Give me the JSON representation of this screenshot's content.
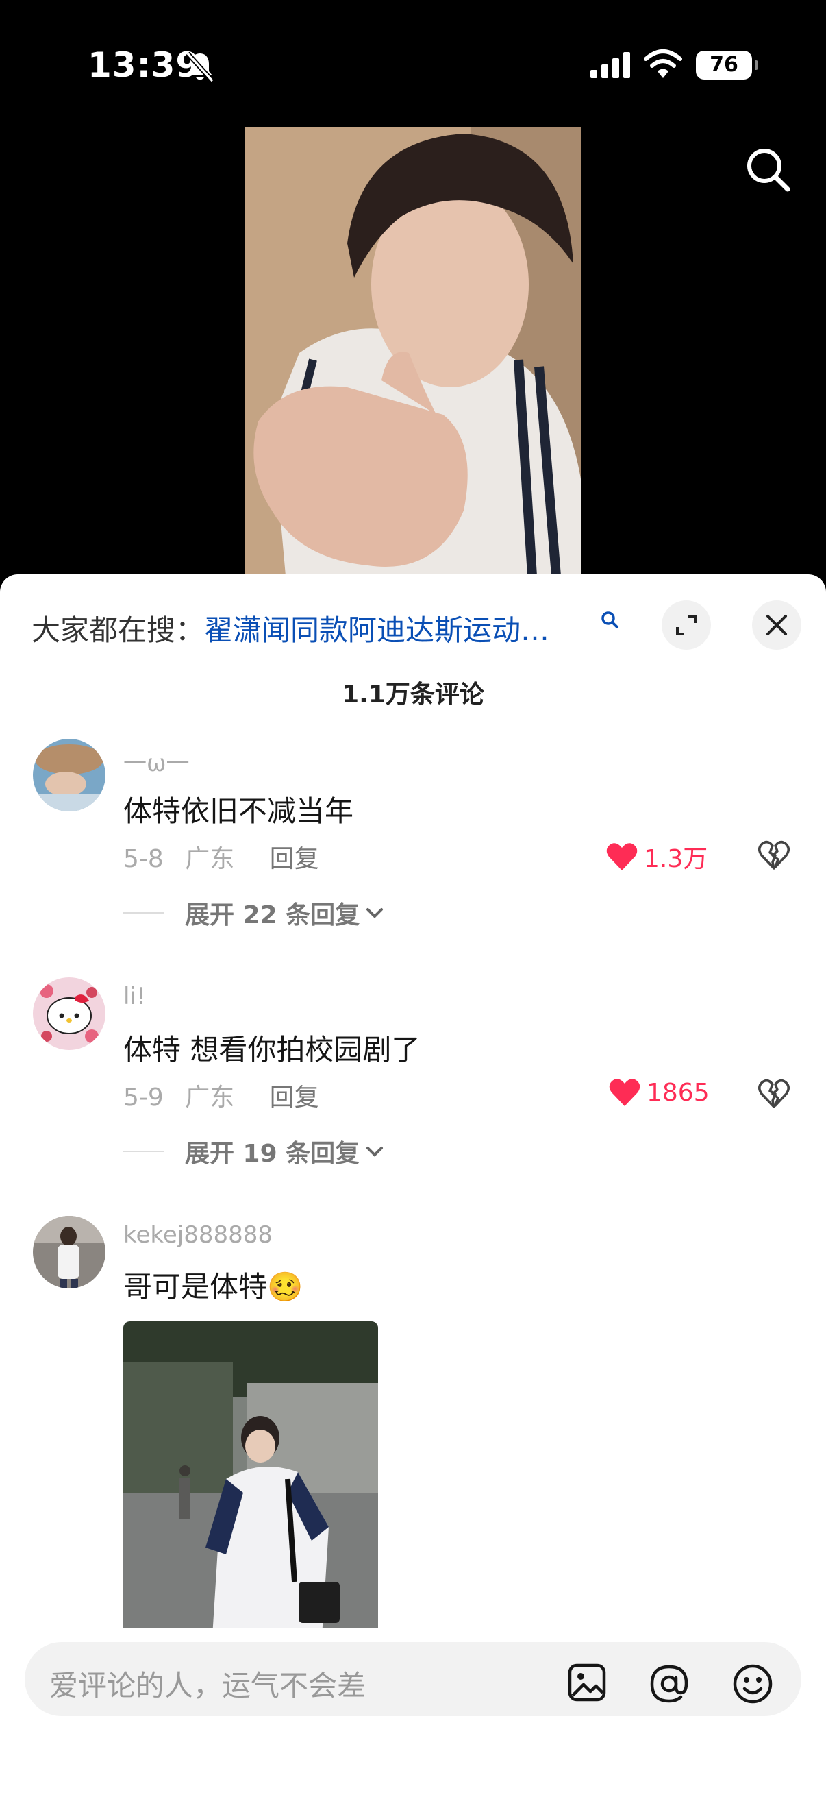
{
  "status": {
    "time": "13:39",
    "battery": "76"
  },
  "sheet": {
    "hot_search_prefix": "大家都在搜：",
    "hot_search_link": "翟潇闻同款阿迪达斯运动…",
    "comment_count": "1.1万条评论"
  },
  "comments": [
    {
      "username": "一ω一",
      "text": "体特依旧不减当年",
      "date": "5-8",
      "location": "广东",
      "reply_label": "回复",
      "likes": "1.3万",
      "expand_label": "展开 22 条回复"
    },
    {
      "username": "li!",
      "text": "体特 想看你拍校园剧了",
      "date": "5-9",
      "location": "广东",
      "reply_label": "回复",
      "likes": "1865",
      "expand_label": "展开 19 条回复"
    },
    {
      "username": "kekej888888",
      "text": "哥可是体特",
      "emoji": "🥴"
    }
  ],
  "input": {
    "placeholder": "爱评论的人，运气不会差"
  },
  "colors": {
    "link": "#0a4fb5",
    "like": "#fe2c55"
  },
  "icons": [
    "bell-off-icon",
    "signal-icon",
    "wifi-icon",
    "search-icon",
    "expand-icon",
    "close-icon",
    "heart-icon",
    "dislike-heart-icon",
    "chevron-down-icon",
    "image-icon",
    "at-icon",
    "emoji-icon"
  ]
}
